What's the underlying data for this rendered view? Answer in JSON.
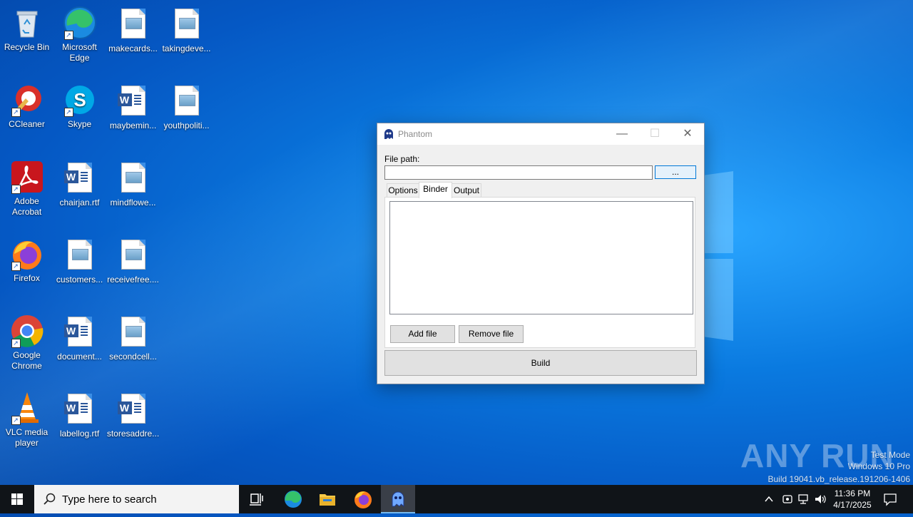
{
  "desktop": {
    "icons": [
      {
        "label": "Recycle Bin"
      },
      {
        "label": "Microsoft Edge"
      },
      {
        "label": "makecards..."
      },
      {
        "label": "takingdeve..."
      },
      {
        "label": "CCleaner"
      },
      {
        "label": "Skype"
      },
      {
        "label": "maybemin..."
      },
      {
        "label": "youthpoliti..."
      },
      {
        "label": "Adobe Acrobat"
      },
      {
        "label": "chairjan.rtf"
      },
      {
        "label": "mindflowe..."
      },
      {
        "label": "Firefox"
      },
      {
        "label": "customers..."
      },
      {
        "label": "receivefree...."
      },
      {
        "label": "Google Chrome"
      },
      {
        "label": "document..."
      },
      {
        "label": "secondcell..."
      },
      {
        "label": "VLC media player"
      },
      {
        "label": "labellog.rtf"
      },
      {
        "label": "storesaddre..."
      }
    ]
  },
  "window": {
    "title": "Phantom",
    "file_path_label": "File path:",
    "file_path_value": "",
    "browse_label": "...",
    "tabs": [
      {
        "label": "Options"
      },
      {
        "label": "Binder"
      },
      {
        "label": "Output"
      }
    ],
    "active_tab": "Binder",
    "add_file_label": "Add file",
    "remove_file_label": "Remove file",
    "build_label": "Build"
  },
  "watermark": {
    "brand": "ANY RUN",
    "line1": "Test Mode",
    "line2": "Windows 10 Pro",
    "line3": "Build 19041.vb_release.191206-1406"
  },
  "taskbar": {
    "search_placeholder": "Type here to search",
    "time": "11:36 PM",
    "date": "4/17/2025"
  }
}
